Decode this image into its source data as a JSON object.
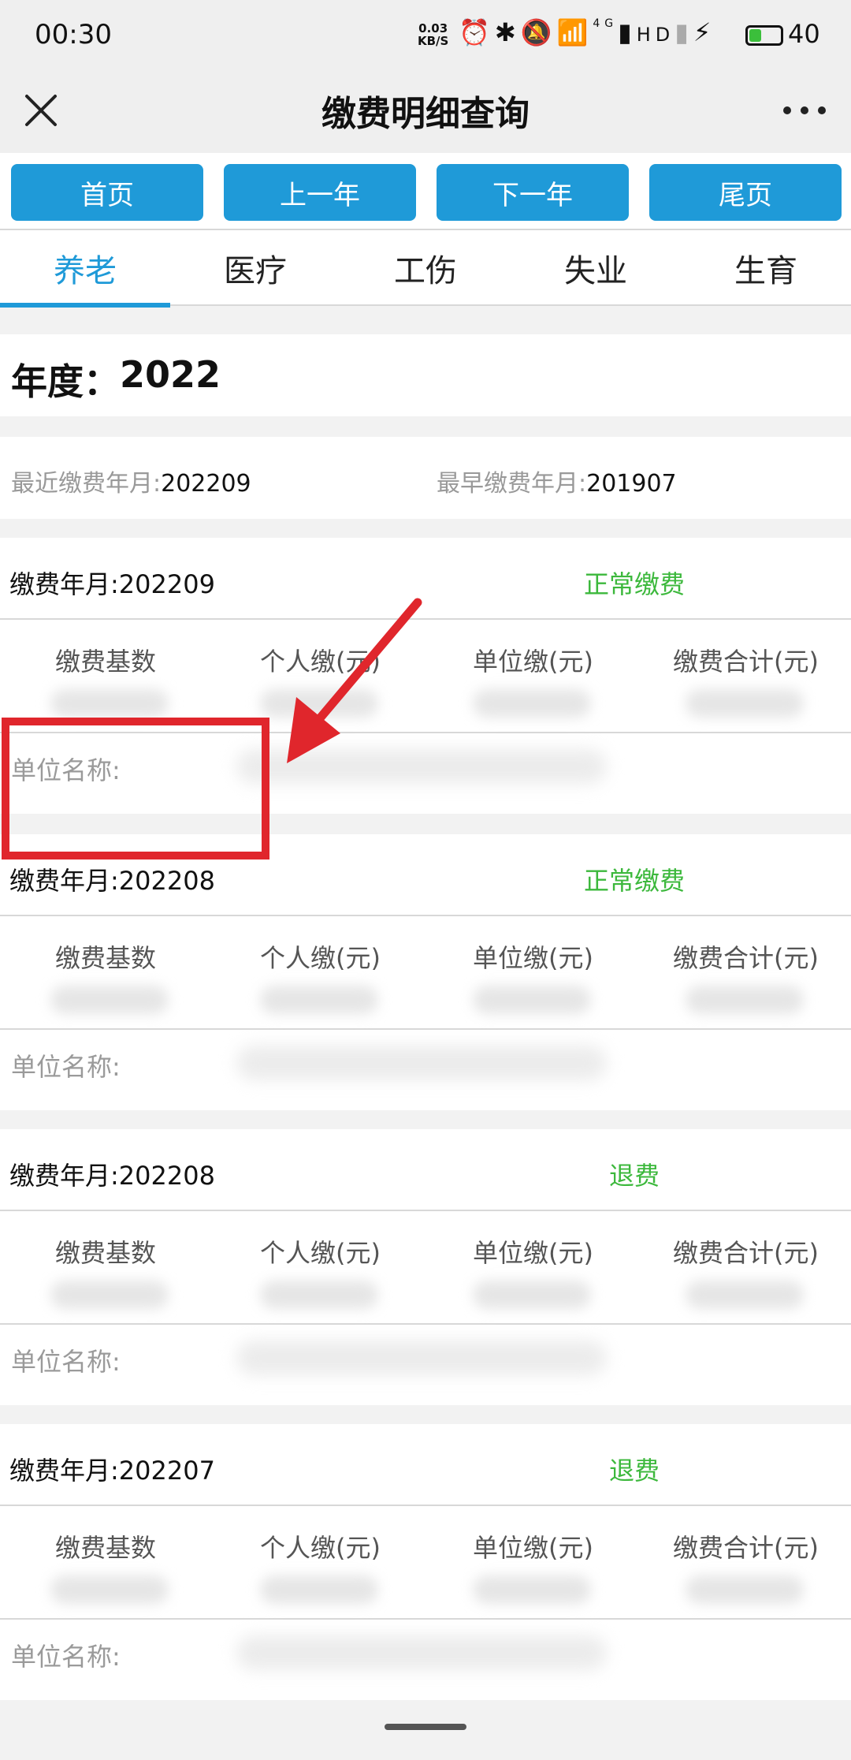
{
  "status_bar": {
    "time": "00:30",
    "net_speed_value": "0.03",
    "net_speed_unit": "KB/S",
    "icons": [
      "alarm-icon",
      "bluetooth-icon",
      "mute-icon",
      "wifi-icon",
      "signal-4g-icon",
      "hd-icon",
      "signal-icon",
      "charging-icon",
      "battery-icon"
    ],
    "signal_label": "4G",
    "hd_label": "HD",
    "battery_level": "40",
    "battery_fraction": 0.4
  },
  "titlebar": {
    "title": "缴费明细查询"
  },
  "nav_buttons": [
    {
      "label": "首页"
    },
    {
      "label": "上一年"
    },
    {
      "label": "下一年"
    },
    {
      "label": "尾页"
    }
  ],
  "tabs": [
    {
      "label": "养老",
      "active": true
    },
    {
      "label": "医疗"
    },
    {
      "label": "工伤"
    },
    {
      "label": "失业"
    },
    {
      "label": "生育"
    }
  ],
  "year": {
    "label": "年度：",
    "value": "2022"
  },
  "summary": {
    "latest_label": "最近缴费年月:",
    "latest_value": "202209",
    "earliest_label": "最早缴费年月:",
    "earliest_value": "201907"
  },
  "columns": [
    "缴费基数",
    "个人缴(元)",
    "单位缴(元)",
    "缴费合计(元)"
  ],
  "unit_name_label": "单位名称:",
  "records": [
    {
      "month_label": "缴费年月:",
      "month": "202209",
      "status": "正常缴费"
    },
    {
      "month_label": "缴费年月:",
      "month": "202208",
      "status": "正常缴费"
    },
    {
      "month_label": "缴费年月:",
      "month": "202208",
      "status": "退费"
    },
    {
      "month_label": "缴费年月:",
      "month": "202207",
      "status": "退费"
    }
  ],
  "colors": {
    "accent": "#1f9ad8",
    "status_green": "#3cb83c",
    "annotation_red": "#e0262c"
  }
}
